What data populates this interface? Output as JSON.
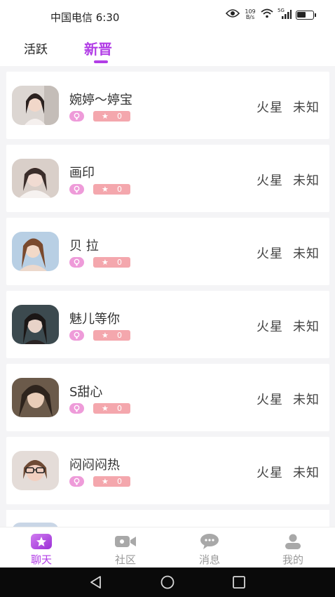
{
  "status_bar": {
    "carrier_time": "中国电信 6:30",
    "speed_value": "109",
    "speed_unit": "B/s",
    "signal_label": "5G",
    "battery_level": 0.55
  },
  "tabs": [
    {
      "label": "活跃"
    },
    {
      "label": "新晋"
    }
  ],
  "users": [
    {
      "name": "婉婷～婷宝",
      "stars": "0",
      "planet": "火星",
      "status": "未知"
    },
    {
      "name": "画印",
      "stars": "0",
      "planet": "火星",
      "status": "未知"
    },
    {
      "name": "贝  拉",
      "stars": "0",
      "planet": "火星",
      "status": "未知"
    },
    {
      "name": "魅儿等你",
      "stars": "0",
      "planet": "火星",
      "status": "未知"
    },
    {
      "name": "S甜心",
      "stars": "0",
      "planet": "火星",
      "status": "未知"
    },
    {
      "name": "闷闷闷热",
      "stars": "0",
      "planet": "火星",
      "status": "未知"
    }
  ],
  "bottom_nav": [
    {
      "label": "聊天",
      "icon": "star-chat-icon"
    },
    {
      "label": "社区",
      "icon": "video-camera-icon"
    },
    {
      "label": "消息",
      "icon": "message-bubble-icon"
    },
    {
      "label": "我的",
      "icon": "user-profile-icon"
    }
  ],
  "colors": {
    "accent": "#b23ee6",
    "gender_badge": "#ee9bd9",
    "star_badge": "#f4a7ad"
  }
}
